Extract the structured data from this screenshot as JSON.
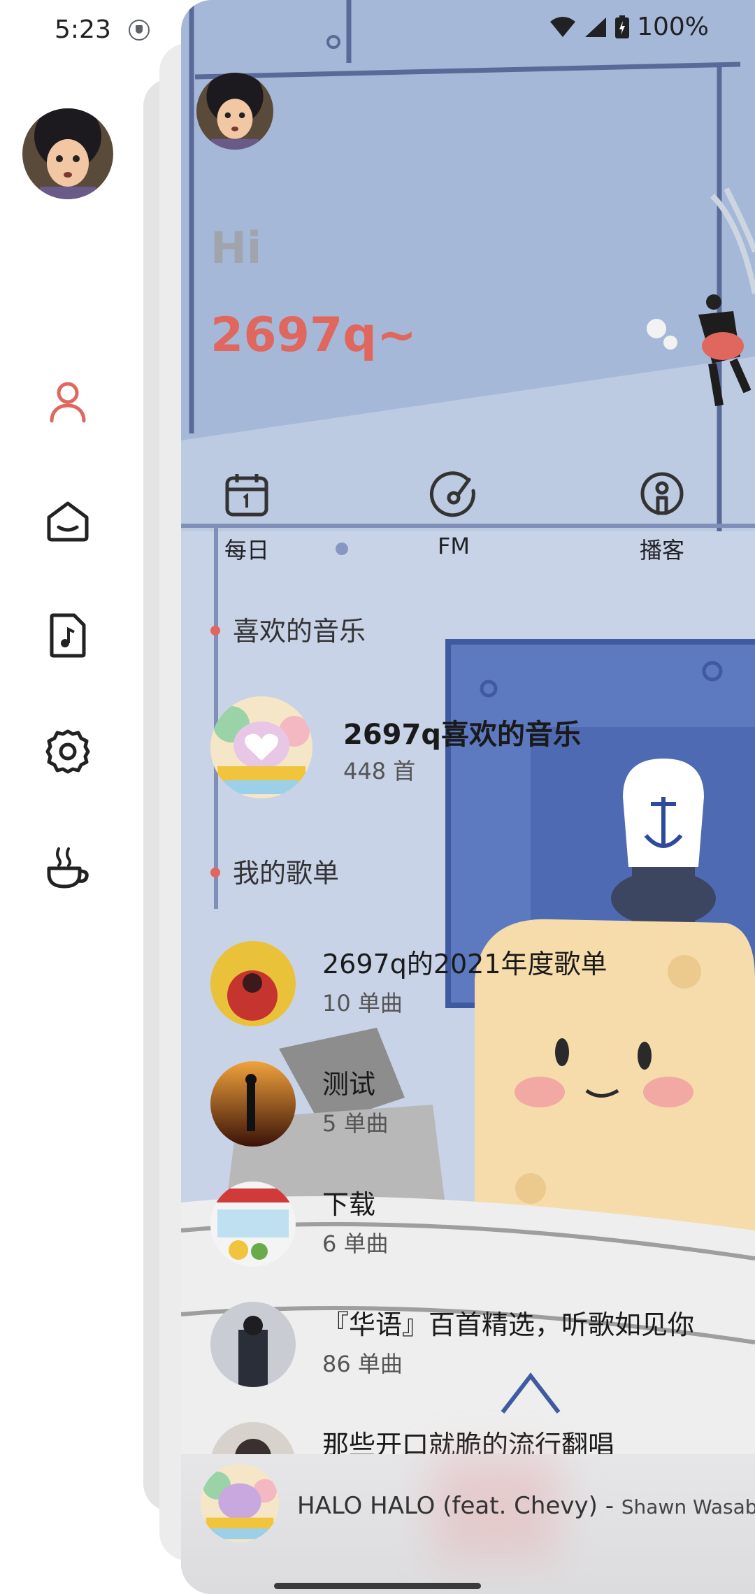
{
  "status": {
    "time": "5:23",
    "battery": "100%"
  },
  "nav": {
    "items": [
      {
        "name": "user",
        "active": true
      },
      {
        "name": "home",
        "active": false
      },
      {
        "name": "music-file",
        "active": false
      },
      {
        "name": "settings",
        "active": false
      },
      {
        "name": "coffee",
        "active": false
      }
    ],
    "active_color": "#e0675e"
  },
  "header": {
    "greeting": "Hi",
    "username": "2697q~"
  },
  "quick_actions": [
    {
      "label": "每日",
      "icon": "calendar-icon"
    },
    {
      "label": "FM",
      "icon": "radio-disc-icon"
    },
    {
      "label": "播客",
      "icon": "podcast-icon"
    }
  ],
  "favorites": {
    "section_title": "喜欢的音乐",
    "title": "2697q喜欢的音乐",
    "count": "448 首"
  },
  "playlists": {
    "section_title": "我的歌单",
    "items": [
      {
        "title": "2697q的2021年度歌单",
        "count": "10 单曲"
      },
      {
        "title": "测试",
        "count": "5 单曲"
      },
      {
        "title": "下载",
        "count": "6 单曲"
      },
      {
        "title": "『华语』百首精选，听歌如见你",
        "count": "86 单曲"
      },
      {
        "title": "那些开口就脆的流行翻唱",
        "count": ""
      }
    ]
  },
  "player": {
    "title": "HALO HALO (feat. Chevy) - ",
    "artist": "Shawn Wasabi"
  },
  "colors": {
    "accent": "#e0675e",
    "card_bg": "#a9b9d6"
  }
}
